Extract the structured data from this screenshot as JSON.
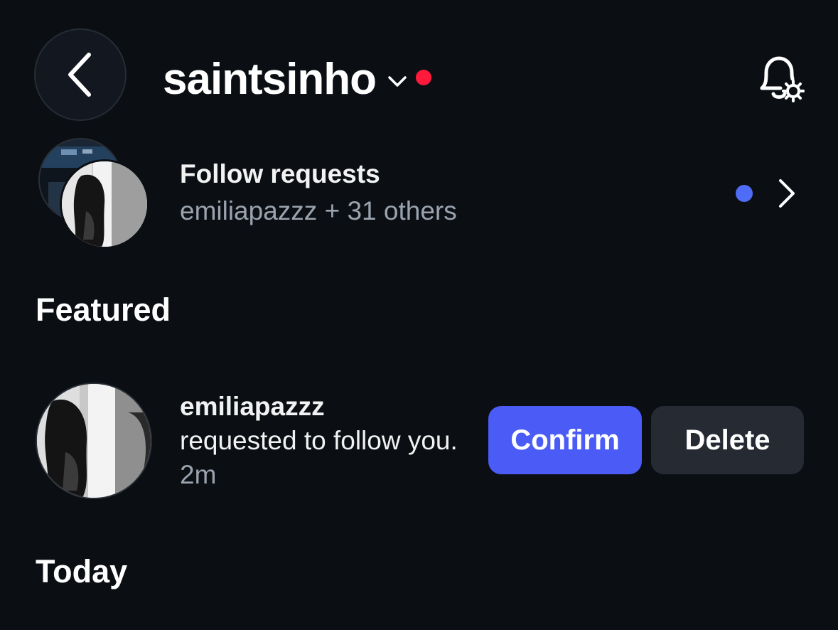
{
  "header": {
    "title": "saintsinho",
    "back_icon": "chevron-left-icon",
    "title_dropdown_icon": "chevron-down-icon",
    "notification_settings_icon": "bell-gear-icon",
    "live_dot_color": "#ff1a3c"
  },
  "follow_requests": {
    "title": "Follow requests",
    "subtitle": "emiliapazzz + 31 others",
    "unread_dot_color": "#4f6cf7",
    "chevron_icon": "chevron-right-icon"
  },
  "sections": {
    "featured": "Featured",
    "today": "Today"
  },
  "featured_request": {
    "username": "emiliapazzz",
    "message": "requested to follow you.",
    "time": "2m",
    "confirm_label": "Confirm",
    "delete_label": "Delete",
    "confirm_color": "#4a5cf5"
  },
  "colors": {
    "background": "#0b0f14",
    "secondary_text": "#9aa3ae",
    "delete_button": "#262b33"
  }
}
